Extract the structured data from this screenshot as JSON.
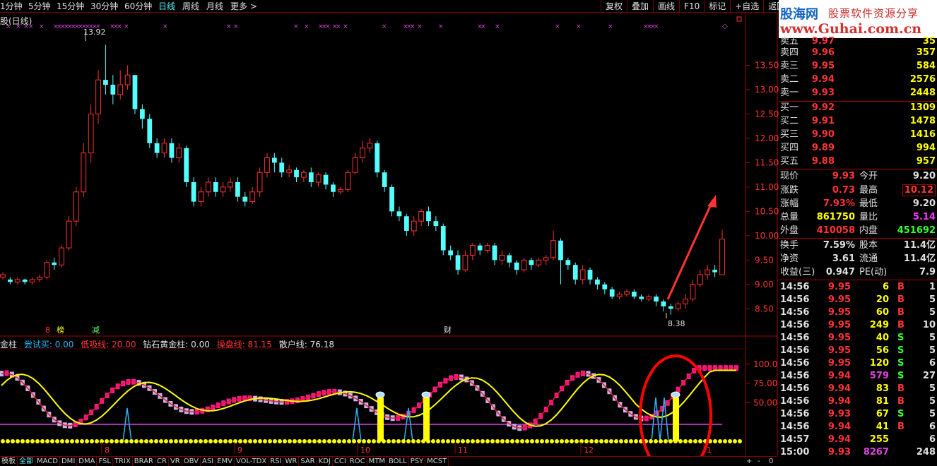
{
  "periods": [
    "1分钟",
    "5分钟",
    "15分钟",
    "30分钟",
    "60分钟",
    "日线",
    "周线",
    "月线",
    "更多 >"
  ],
  "tools": [
    "复权",
    "叠加",
    "画线",
    "F10",
    "标记",
    "+自选",
    "返回"
  ],
  "brand": {
    "name": "股海网",
    "slogan": "股票软件资源分享",
    "url": "www.Guhai.com.cn"
  },
  "chart_title": "股(日线)",
  "price_axis": [
    "13.50",
    "13.00",
    "12.50",
    "12.00",
    "11.50",
    "11.00",
    "10.50",
    "10.00",
    "9.50",
    "9.00",
    "8.50"
  ],
  "price_annotations": {
    "high": "13.92",
    "low": "8.38"
  },
  "markers": {
    "m1": "8",
    "m2": "榜",
    "m3": "减",
    "m4": "财"
  },
  "indicator_legend": [
    {
      "label": "金柱",
      "color": "#e0e0e0"
    },
    {
      "label": "尝试买: 0.00",
      "color": "#29b6f6"
    },
    {
      "label": "低吸线: 20.00",
      "color": "#f33"
    },
    {
      "label": "钻石黄金柱: 0.00",
      "color": "#e0e0e0"
    },
    {
      "label": "操盘线: 81.15",
      "color": "#f33"
    },
    {
      "label": "散户线: 76.18",
      "color": "#e0e0e0"
    }
  ],
  "ind_axis": [
    "100.0",
    "75.00",
    "50.00"
  ],
  "date_labels": [
    "8",
    "9",
    "10",
    "11",
    "12",
    "1"
  ],
  "sells": [
    {
      "label": "卖五",
      "price": "9.97",
      "vol": "35"
    },
    {
      "label": "卖四",
      "price": "9.96",
      "vol": "357"
    },
    {
      "label": "卖三",
      "price": "9.95",
      "vol": "584"
    },
    {
      "label": "卖二",
      "price": "9.94",
      "vol": "2576"
    },
    {
      "label": "卖一",
      "price": "9.93",
      "vol": "2448"
    }
  ],
  "buys": [
    {
      "label": "买一",
      "price": "9.92",
      "vol": "1309"
    },
    {
      "label": "买二",
      "price": "9.91",
      "vol": "1478"
    },
    {
      "label": "买三",
      "price": "9.90",
      "vol": "1416"
    },
    {
      "label": "买四",
      "price": "9.89",
      "vol": "994"
    },
    {
      "label": "买五",
      "price": "9.88",
      "vol": "957"
    }
  ],
  "quote": {
    "k_now": "现价",
    "v_now": "9.93",
    "k_open": "今开",
    "v_open": "9.20",
    "k_chg": "涨跌",
    "v_chg": "0.73",
    "k_high": "最高",
    "v_high": "10.12",
    "k_pct": "涨幅",
    "v_pct": "7.93%",
    "k_low": "最低",
    "v_low": "9.20",
    "k_vol": "总量",
    "v_vol": "861750",
    "k_ratio": "量比",
    "v_ratio": "5.14",
    "k_out": "外盘",
    "v_out": "410058",
    "k_in": "内盘",
    "v_in": "451692",
    "k_turn": "换手",
    "v_turn": "7.59%",
    "k_eq": "股本",
    "v_eq": "11.4亿",
    "k_na": "净资",
    "v_na": "3.61",
    "k_float": "流通",
    "v_float": "11.4亿",
    "k_eps": "收益(三)",
    "v_eps": "0.947",
    "k_pe": "PE(动)",
    "v_pe": "7.9"
  },
  "ticks": [
    {
      "t": "14:56",
      "p": "9.95",
      "v": "6",
      "d": "B",
      "n": "1"
    },
    {
      "t": "14:56",
      "p": "9.95",
      "v": "20",
      "d": "B",
      "n": "5"
    },
    {
      "t": "14:56",
      "p": "9.95",
      "v": "60",
      "d": "B",
      "n": "5"
    },
    {
      "t": "14:56",
      "p": "9.95",
      "v": "249",
      "d": "B",
      "n": "10"
    },
    {
      "t": "14:56",
      "p": "9.95",
      "v": "40",
      "d": "S",
      "n": "5"
    },
    {
      "t": "14:56",
      "p": "9.95",
      "v": "56",
      "d": "S",
      "n": "5"
    },
    {
      "t": "14:56",
      "p": "9.95",
      "v": "120",
      "d": "S",
      "n": "6"
    },
    {
      "t": "14:56",
      "p": "9.94",
      "v": "579",
      "d": "S",
      "n": "27"
    },
    {
      "t": "14:56",
      "p": "9.94",
      "v": "83",
      "d": "B",
      "n": "5"
    },
    {
      "t": "14:56",
      "p": "9.94",
      "v": "81",
      "d": "B",
      "n": "5"
    },
    {
      "t": "14:56",
      "p": "9.93",
      "v": "67",
      "d": "S",
      "n": "5"
    },
    {
      "t": "14:56",
      "p": "9.94",
      "v": "41",
      "d": "B",
      "n": "6"
    },
    {
      "t": "14:57",
      "p": "9.94",
      "v": "255",
      "d": "",
      "n": "6"
    },
    {
      "t": "15:00",
      "p": "9.93",
      "v": "8267",
      "d": "",
      "n": "248"
    }
  ],
  "bottom_tabs": [
    "模板",
    "全部",
    "MACD",
    "DMI",
    "DMA",
    "FSL",
    "TRIX",
    "BRAR",
    "CR",
    "VR",
    "OBV",
    "ASI",
    "EMV",
    "VOL-TDX",
    "RSI",
    "WR",
    "SAR",
    "KDJ",
    "CCI",
    "ROC",
    "MTM",
    "BOLL",
    "PSY",
    "MCST"
  ],
  "bottom_right": [
    "+",
    "-",
    "0"
  ],
  "colors": {
    "up": "#ff3232",
    "down": "#54ffff",
    "axis": "#a00000",
    "yellow": "#ffff00"
  },
  "chart_data": {
    "type": "candlestick",
    "ylim": [
      8.2,
      14.0
    ],
    "y_ticks": [
      8.5,
      9.0,
      9.5,
      10.0,
      10.5,
      11.0,
      11.5,
      12.0,
      12.5,
      13.0,
      13.5
    ],
    "candles": [
      [
        9.15,
        9.2,
        9.1,
        9.25
      ],
      [
        9.1,
        9.05,
        9.0,
        9.15
      ],
      [
        9.05,
        9.1,
        9.0,
        9.15
      ],
      [
        9.1,
        9.05,
        9.0,
        9.12
      ],
      [
        9.05,
        9.1,
        9.0,
        9.15
      ],
      [
        9.1,
        9.15,
        9.05,
        9.2
      ],
      [
        9.15,
        9.45,
        9.1,
        9.5
      ],
      [
        9.45,
        9.4,
        9.3,
        9.55
      ],
      [
        9.4,
        9.75,
        9.35,
        9.8
      ],
      [
        9.75,
        10.3,
        9.7,
        10.4
      ],
      [
        10.3,
        10.9,
        10.2,
        11.0
      ],
      [
        10.9,
        11.7,
        10.8,
        11.9
      ],
      [
        11.7,
        12.5,
        11.5,
        12.7
      ],
      [
        12.5,
        13.2,
        12.3,
        13.4
      ],
      [
        13.2,
        13.1,
        12.9,
        13.92
      ],
      [
        13.1,
        12.9,
        12.7,
        13.3
      ],
      [
        12.9,
        13.1,
        12.8,
        13.4
      ],
      [
        13.1,
        13.3,
        13.0,
        13.5
      ],
      [
        13.3,
        12.6,
        12.5,
        13.3
      ],
      [
        12.6,
        12.4,
        12.2,
        12.7
      ],
      [
        12.4,
        11.9,
        11.8,
        12.5
      ],
      [
        11.9,
        11.7,
        11.6,
        12.0
      ],
      [
        11.7,
        11.9,
        11.6,
        12.0
      ],
      [
        11.9,
        11.6,
        11.5,
        12.0
      ],
      [
        11.6,
        11.8,
        11.5,
        11.9
      ],
      [
        11.8,
        11.1,
        11.0,
        11.85
      ],
      [
        11.1,
        10.7,
        10.6,
        11.2
      ],
      [
        10.7,
        10.9,
        10.6,
        11.0
      ],
      [
        10.9,
        11.1,
        10.8,
        11.2
      ],
      [
        11.1,
        10.9,
        10.8,
        11.2
      ],
      [
        10.9,
        11.0,
        10.8,
        11.1
      ],
      [
        11.0,
        11.1,
        10.9,
        11.2
      ],
      [
        11.1,
        10.8,
        10.7,
        11.2
      ],
      [
        10.8,
        10.7,
        10.6,
        10.9
      ],
      [
        10.7,
        10.9,
        10.65,
        11.0
      ],
      [
        10.9,
        11.3,
        10.8,
        11.4
      ],
      [
        11.3,
        11.6,
        11.2,
        11.7
      ],
      [
        11.6,
        11.5,
        11.3,
        11.7
      ],
      [
        11.5,
        11.3,
        11.2,
        11.6
      ],
      [
        11.3,
        11.35,
        11.2,
        11.45
      ],
      [
        11.35,
        11.2,
        11.1,
        11.4
      ],
      [
        11.2,
        11.3,
        11.1,
        11.35
      ],
      [
        11.3,
        11.1,
        11.0,
        11.4
      ],
      [
        11.1,
        11.25,
        11.0,
        11.3
      ],
      [
        11.25,
        11.05,
        10.95,
        11.3
      ],
      [
        11.05,
        10.9,
        10.8,
        11.1
      ],
      [
        10.9,
        10.95,
        10.85,
        11.0
      ],
      [
        10.95,
        11.3,
        10.9,
        11.35
      ],
      [
        11.3,
        11.6,
        11.25,
        11.7
      ],
      [
        11.6,
        11.8,
        11.5,
        11.95
      ],
      [
        11.8,
        11.9,
        11.7,
        12.0
      ],
      [
        11.9,
        11.3,
        11.2,
        11.95
      ],
      [
        11.3,
        11.0,
        10.9,
        11.35
      ],
      [
        11.0,
        10.5,
        10.4,
        11.05
      ],
      [
        10.5,
        10.4,
        10.3,
        10.6
      ],
      [
        10.4,
        10.1,
        10.0,
        10.45
      ],
      [
        10.1,
        10.3,
        10.0,
        10.4
      ],
      [
        10.3,
        10.5,
        10.2,
        10.55
      ],
      [
        10.5,
        10.3,
        10.2,
        10.6
      ],
      [
        10.3,
        10.2,
        10.1,
        10.4
      ],
      [
        10.2,
        9.7,
        9.6,
        10.25
      ],
      [
        9.7,
        9.6,
        9.5,
        9.8
      ],
      [
        9.6,
        9.3,
        9.2,
        9.7
      ],
      [
        9.3,
        9.6,
        9.25,
        9.7
      ],
      [
        9.6,
        9.8,
        9.5,
        9.85
      ],
      [
        9.8,
        9.7,
        9.6,
        9.85
      ],
      [
        9.7,
        9.8,
        9.65,
        9.85
      ],
      [
        9.8,
        9.5,
        9.4,
        9.85
      ],
      [
        9.5,
        9.6,
        9.4,
        9.7
      ],
      [
        9.6,
        9.45,
        9.35,
        9.65
      ],
      [
        9.45,
        9.3,
        9.2,
        9.5
      ],
      [
        9.3,
        9.5,
        9.25,
        9.55
      ],
      [
        9.5,
        9.4,
        9.3,
        9.55
      ],
      [
        9.4,
        9.5,
        9.35,
        9.55
      ],
      [
        9.5,
        9.55,
        9.4,
        9.6
      ],
      [
        9.55,
        9.9,
        9.5,
        10.1
      ],
      [
        9.9,
        9.5,
        9.0,
        9.95
      ],
      [
        9.5,
        9.4,
        9.3,
        9.55
      ],
      [
        9.4,
        9.1,
        9.0,
        9.45
      ],
      [
        9.1,
        9.3,
        9.0,
        9.4
      ],
      [
        9.3,
        9.1,
        9.0,
        9.35
      ],
      [
        9.1,
        9.0,
        8.9,
        9.15
      ],
      [
        9.0,
        8.9,
        8.8,
        9.05
      ],
      [
        8.9,
        8.75,
        8.7,
        8.95
      ],
      [
        8.75,
        8.8,
        8.7,
        8.85
      ],
      [
        8.8,
        8.85,
        8.75,
        8.9
      ],
      [
        8.85,
        8.75,
        8.7,
        8.9
      ],
      [
        8.75,
        8.7,
        8.65,
        8.8
      ],
      [
        8.7,
        8.75,
        8.65,
        8.8
      ],
      [
        8.75,
        8.65,
        8.55,
        8.8
      ],
      [
        8.65,
        8.55,
        8.45,
        8.7
      ],
      [
        8.55,
        8.5,
        8.38,
        8.6
      ],
      [
        8.5,
        8.6,
        8.45,
        8.65
      ],
      [
        8.6,
        8.7,
        8.5,
        8.8
      ],
      [
        8.7,
        9.0,
        8.65,
        9.1
      ],
      [
        9.0,
        9.2,
        8.95,
        9.3
      ],
      [
        9.2,
        9.3,
        9.1,
        9.4
      ],
      [
        9.3,
        9.25,
        9.15,
        9.4
      ],
      [
        9.2,
        9.93,
        9.2,
        10.12
      ]
    ]
  }
}
